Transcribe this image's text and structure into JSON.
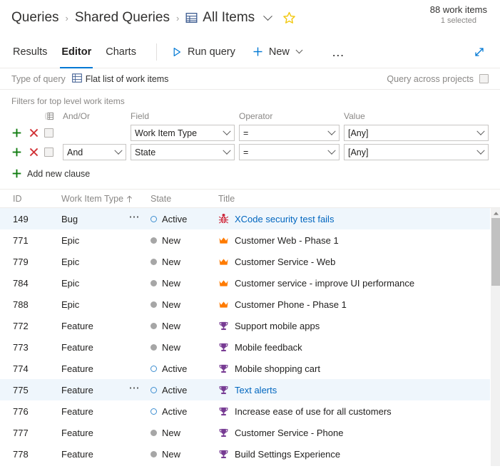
{
  "header": {
    "breadcrumb": [
      {
        "label": "Queries",
        "icon": null
      },
      {
        "label": "Shared Queries",
        "icon": null
      },
      {
        "label": "All Items",
        "icon": "grid-table-icon"
      }
    ],
    "separator": "›",
    "favorite_icon": "star-outline-icon",
    "count_main": "88 work items",
    "count_sub": "1 selected"
  },
  "commandbar": {
    "tabs": [
      {
        "label": "Results",
        "active": false
      },
      {
        "label": "Editor",
        "active": true
      },
      {
        "label": "Charts",
        "active": false
      }
    ],
    "run_query_label": "Run query",
    "run_query_icon": "play-triangle-icon",
    "new_label": "New",
    "new_icon": "plus-icon",
    "new_chevron_icon": "chevron-down-icon",
    "overflow_label": "…",
    "overflow_icon": "ellipsis-icon",
    "expand_icon": "expand-diagonal-icon",
    "accent_color": "#0078d4"
  },
  "querytype": {
    "label": "Type of query",
    "value": "Flat list of work items",
    "value_icon": "flat-list-icon",
    "across_projects_label": "Query across projects",
    "across_projects_checked": false
  },
  "filters": {
    "title": "Filters for top level work items",
    "columns": {
      "ops": "",
      "checkbox_icon": "group-clauses-icon",
      "andor": "And/Or",
      "field": "Field",
      "operator": "Operator",
      "value": "Value"
    },
    "add_icon": "plus-green-icon",
    "delete_icon": "x-red-icon",
    "rows": [
      {
        "andor": "",
        "andor_visible": false,
        "field": "Work Item Type",
        "operator": "=",
        "value": "[Any]",
        "checked": false
      },
      {
        "andor": "And",
        "andor_visible": true,
        "field": "State",
        "operator": "=",
        "value": "[Any]",
        "checked": false
      }
    ],
    "add_clause_label": "Add new clause",
    "add_clause_icon": "plus-green-icon"
  },
  "grid": {
    "columns": [
      {
        "label": "ID",
        "sorted": false
      },
      {
        "label": "Work Item Type",
        "sorted": true,
        "sort_icon": "arrow-up-icon"
      },
      {
        "label": "State",
        "sorted": false
      },
      {
        "label": "Title",
        "sorted": false
      }
    ],
    "rows": [
      {
        "id": "149",
        "type": "Bug",
        "state": "Active",
        "state_kind": "active",
        "title": "XCode security test fails",
        "icon": "bug-icon",
        "selected": true,
        "dots": true,
        "link": true
      },
      {
        "id": "771",
        "type": "Epic",
        "state": "New",
        "state_kind": "new",
        "title": "Customer Web - Phase 1",
        "icon": "crown-icon",
        "selected": false,
        "dots": false,
        "link": false
      },
      {
        "id": "779",
        "type": "Epic",
        "state": "New",
        "state_kind": "new",
        "title": "Customer Service - Web",
        "icon": "crown-icon",
        "selected": false,
        "dots": false,
        "link": false
      },
      {
        "id": "784",
        "type": "Epic",
        "state": "New",
        "state_kind": "new",
        "title": "Customer service - improve UI performance",
        "icon": "crown-icon",
        "selected": false,
        "dots": false,
        "link": false
      },
      {
        "id": "788",
        "type": "Epic",
        "state": "New",
        "state_kind": "new",
        "title": "Customer Phone - Phase 1",
        "icon": "crown-icon",
        "selected": false,
        "dots": false,
        "link": false
      },
      {
        "id": "772",
        "type": "Feature",
        "state": "New",
        "state_kind": "new",
        "title": "Support mobile apps",
        "icon": "trophy-icon",
        "selected": false,
        "dots": false,
        "link": false
      },
      {
        "id": "773",
        "type": "Feature",
        "state": "New",
        "state_kind": "new",
        "title": "Mobile feedback",
        "icon": "trophy-icon",
        "selected": false,
        "dots": false,
        "link": false
      },
      {
        "id": "774",
        "type": "Feature",
        "state": "Active",
        "state_kind": "active",
        "title": "Mobile shopping cart",
        "icon": "trophy-icon",
        "selected": false,
        "dots": false,
        "link": false
      },
      {
        "id": "775",
        "type": "Feature",
        "state": "Active",
        "state_kind": "active",
        "title": "Text alerts",
        "icon": "trophy-icon",
        "selected": true,
        "dots": true,
        "link": true
      },
      {
        "id": "776",
        "type": "Feature",
        "state": "Active",
        "state_kind": "active",
        "title": "Increase ease of use for all customers",
        "icon": "trophy-icon",
        "selected": false,
        "dots": false,
        "link": false
      },
      {
        "id": "777",
        "type": "Feature",
        "state": "New",
        "state_kind": "new",
        "title": "Customer Service - Phone",
        "icon": "trophy-icon",
        "selected": false,
        "dots": false,
        "link": false
      },
      {
        "id": "778",
        "type": "Feature",
        "state": "New",
        "state_kind": "new",
        "title": "Build Settings Experience",
        "icon": "trophy-icon",
        "selected": false,
        "dots": false,
        "link": false
      }
    ],
    "scrollbar": {
      "up_icon": "scroll-up-arrow-icon",
      "thumb": "scroll-thumb"
    }
  },
  "colors": {
    "accent": "#0078d4",
    "link": "#0066bf",
    "bug": "#cc293d",
    "epic": "#ff7b00",
    "feature": "#773b93",
    "state_new": "#a6a6a6",
    "state_active": "#3e8ed0",
    "favorite": "#f2c811",
    "add": "#107c10",
    "delete": "#d13438",
    "row_selected": "#eff6fc"
  }
}
